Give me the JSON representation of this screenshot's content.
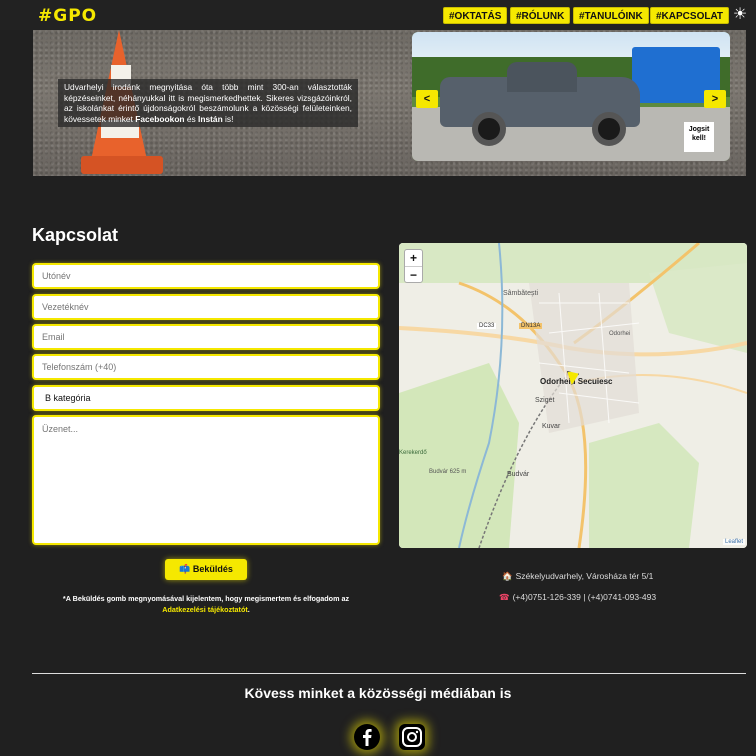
{
  "header": {
    "logo": "#GPO",
    "nav": [
      "#OKTATÁS",
      "#RÓLUNK",
      "#TANULÓINK",
      "#KAPCSOLAT"
    ],
    "theme_icon": "sun-icon"
  },
  "hero": {
    "text_part1": "Udvarhelyi irodánk megnyitása óta több mint 300-an választották képzéseinket, néhányukkal itt is megismerkedhettek. Sikeres vizsgázóinkról, az iskolánkat érintő újdonságokról beszámolunk a közösségi felületeinken, kövessetek minket ",
    "link1": "Facebookon",
    "text_part2": " és ",
    "link2": "Instán",
    "text_part3": " is!",
    "prev_label": "<",
    "next_label": ">",
    "sign_text": "Jogsit kell!"
  },
  "contact": {
    "title": "Kapcsolat",
    "fields": {
      "first_name": "Utónév",
      "last_name": "Vezetéknév",
      "email": "Email",
      "phone": "Telefonszám (+40)",
      "category": "B kategória",
      "message": "Üzenet..."
    },
    "send_label": "📫 Beküldés",
    "disclaimer_text": "*A Beküldés gomb megnyomásával kijelentem, hogy megismertem és elfogadom az ",
    "disclaimer_link": "Adatkezelési tájékoztatót",
    "disclaimer_end": "."
  },
  "map": {
    "zoom_in": "+",
    "zoom_out": "−",
    "attribution": "Leaflet",
    "labels": {
      "szombatfalva": "Sâmbătești",
      "odorhei": "Odorheiu Secuiesc",
      "sziget": "Sziget",
      "kuvar": "Kuvar",
      "budvar": "Budvár",
      "dc33": "DC33",
      "dn13a": "DN13A",
      "odorhei2": "Odorhei",
      "budvar2": "Budvár 625 m",
      "kerekerdo": "Kerekerdő"
    }
  },
  "address": "Székelyudvarhely, Városháza tér 5/1",
  "phones": "(+4)0751-126-339 | (+4)0741-093-493",
  "social": {
    "title": "Kövess minket a közösségi médiában is"
  },
  "colors": {
    "accent": "#f5e800",
    "background": "#202020"
  }
}
